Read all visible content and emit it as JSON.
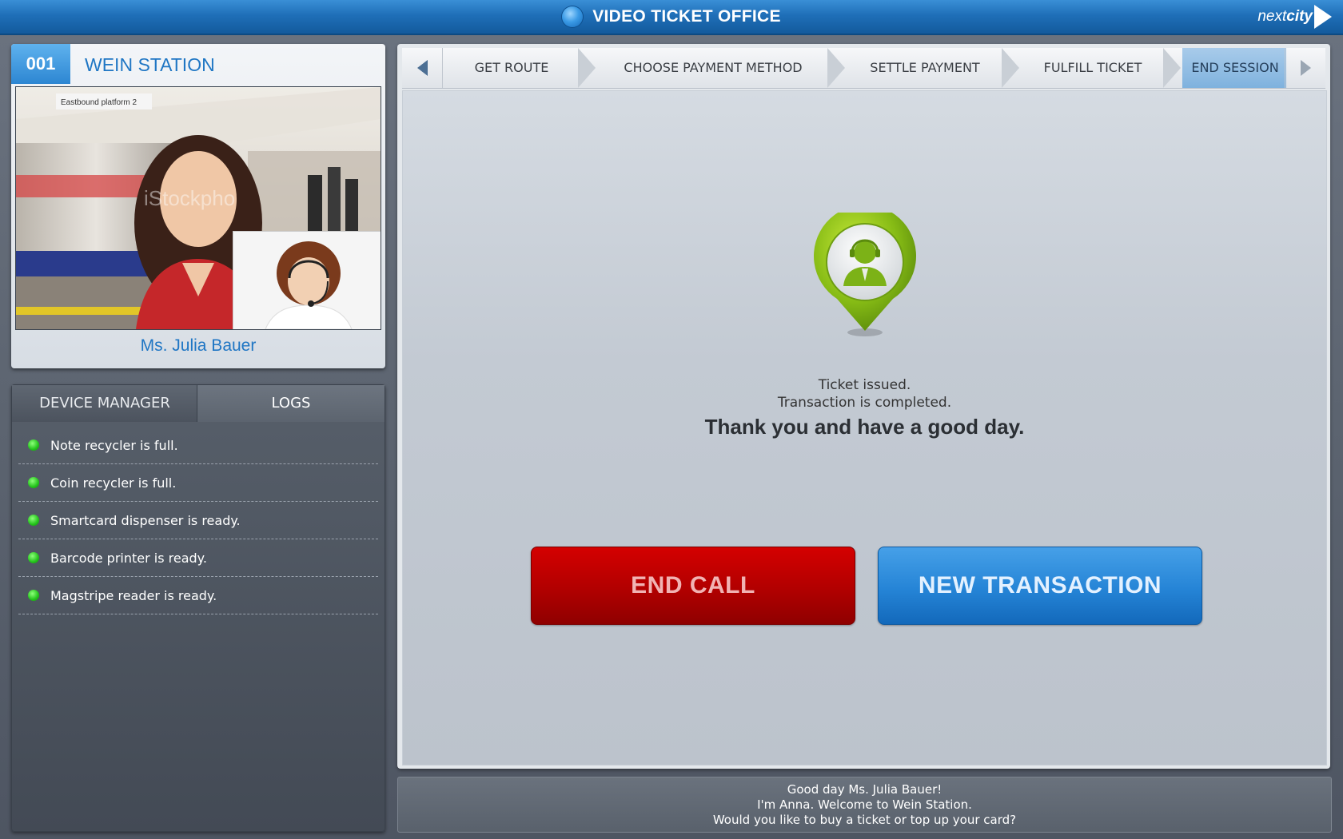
{
  "app": {
    "title": "VIDEO TICKET OFFICE",
    "logo_prefix": "next",
    "logo_suffix": "city"
  },
  "station": {
    "number": "001",
    "name": "WEIN STATION",
    "customer_name": "Ms. Julia Bauer"
  },
  "video": {
    "watermark": "iStockpho",
    "sign_text": "Eastbound platform 2"
  },
  "tabs": [
    {
      "label": "DEVICE MANAGER",
      "active": false
    },
    {
      "label": "LOGS",
      "active": true
    }
  ],
  "logs": [
    {
      "text": "Note recycler is full.",
      "status_color": "#22c21a"
    },
    {
      "text": "Coin recycler is full.",
      "status_color": "#22c21a"
    },
    {
      "text": "Smartcard dispenser is ready.",
      "status_color": "#22c21a"
    },
    {
      "text": "Barcode printer is ready.",
      "status_color": "#22c21a"
    },
    {
      "text": "Magstripe reader is ready.",
      "status_color": "#22c21a"
    }
  ],
  "steps": [
    {
      "label": "GET ROUTE",
      "active": false
    },
    {
      "label": "CHOOSE PAYMENT METHOD",
      "active": false
    },
    {
      "label": "SETTLE PAYMENT",
      "active": false
    },
    {
      "label": "FULFILL TICKET",
      "active": false
    },
    {
      "label": "END SESSION",
      "active": true
    }
  ],
  "status": {
    "line1": "Ticket issued.",
    "line2": "Transaction is completed.",
    "line3": "Thank you and have a good day."
  },
  "buttons": {
    "end_call": "END CALL",
    "new_transaction": "NEW TRANSACTION"
  },
  "greeting": [
    "Good day Ms. Julia Bauer!",
    "I'm Anna. Welcome to Wein Station.",
    "Would you like to buy a ticket or top up your card?"
  ],
  "colors": {
    "accent": "#1f76c4",
    "danger": "#b10000",
    "primary": "#2584d6",
    "ok": "#22c21a"
  },
  "icons": {
    "agent": "agent-headset-pin-icon",
    "prev": "arrow-left-icon",
    "next": "arrow-right-icon",
    "globe": "globe-icon"
  }
}
